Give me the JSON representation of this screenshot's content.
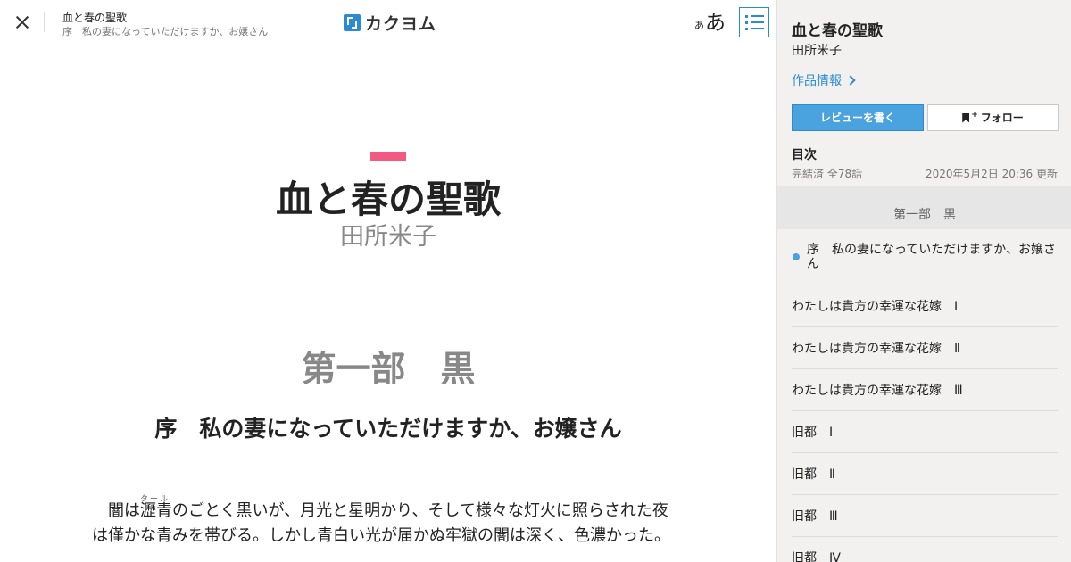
{
  "topbar": {
    "work_title": "血と春の聖歌",
    "episode": "序　私の妻になっていただけますか、お嬢さん",
    "brand": "カクヨム",
    "font_small": "あ",
    "font_big": "あ"
  },
  "content": {
    "title": "血と春の聖歌",
    "author": "田所米子",
    "part": "第一部　黒",
    "episode_title": "序　私の妻になっていただけますか、お嬢さん",
    "ruby_base": "瀝青",
    "ruby_text": "タール",
    "line1_before": "　闇は",
    "line1_after": "のごとく黒いが、月光と星明かり、そして様々な灯火に照らされた夜",
    "line2": "は僅かな青みを帯びる。しかし青白い光が届かぬ牢獄の闇は深く、色濃かった。"
  },
  "side": {
    "title": "血と春の聖歌",
    "author": "田所米子",
    "info_link": "作品情報",
    "review_button": "レビューを書く",
    "follow_button": "フォロー",
    "toc_heading": "目次",
    "status": "完結済 全78話",
    "updated": "2020年5月2日 20:36 更新",
    "part_header": "第一部　黒",
    "episodes": [
      "序　私の妻になっていただけますか、お嬢さん",
      "わたしは貴方の幸運な花嫁　Ⅰ",
      "わたしは貴方の幸運な花嫁　Ⅱ",
      "わたしは貴方の幸運な花嫁　Ⅲ",
      "旧都　Ⅰ",
      "旧都　Ⅱ",
      "旧都　Ⅲ",
      "旧都　Ⅳ"
    ]
  },
  "colors": {
    "accent": "#2b8ad0",
    "button_blue": "#4aa3df",
    "title_mark": "#f25a83"
  },
  "icons": [
    "close-icon",
    "brand-logo-icon",
    "font-size-icon",
    "toc-list-icon",
    "chevron-right-icon",
    "bookmark-icon"
  ]
}
